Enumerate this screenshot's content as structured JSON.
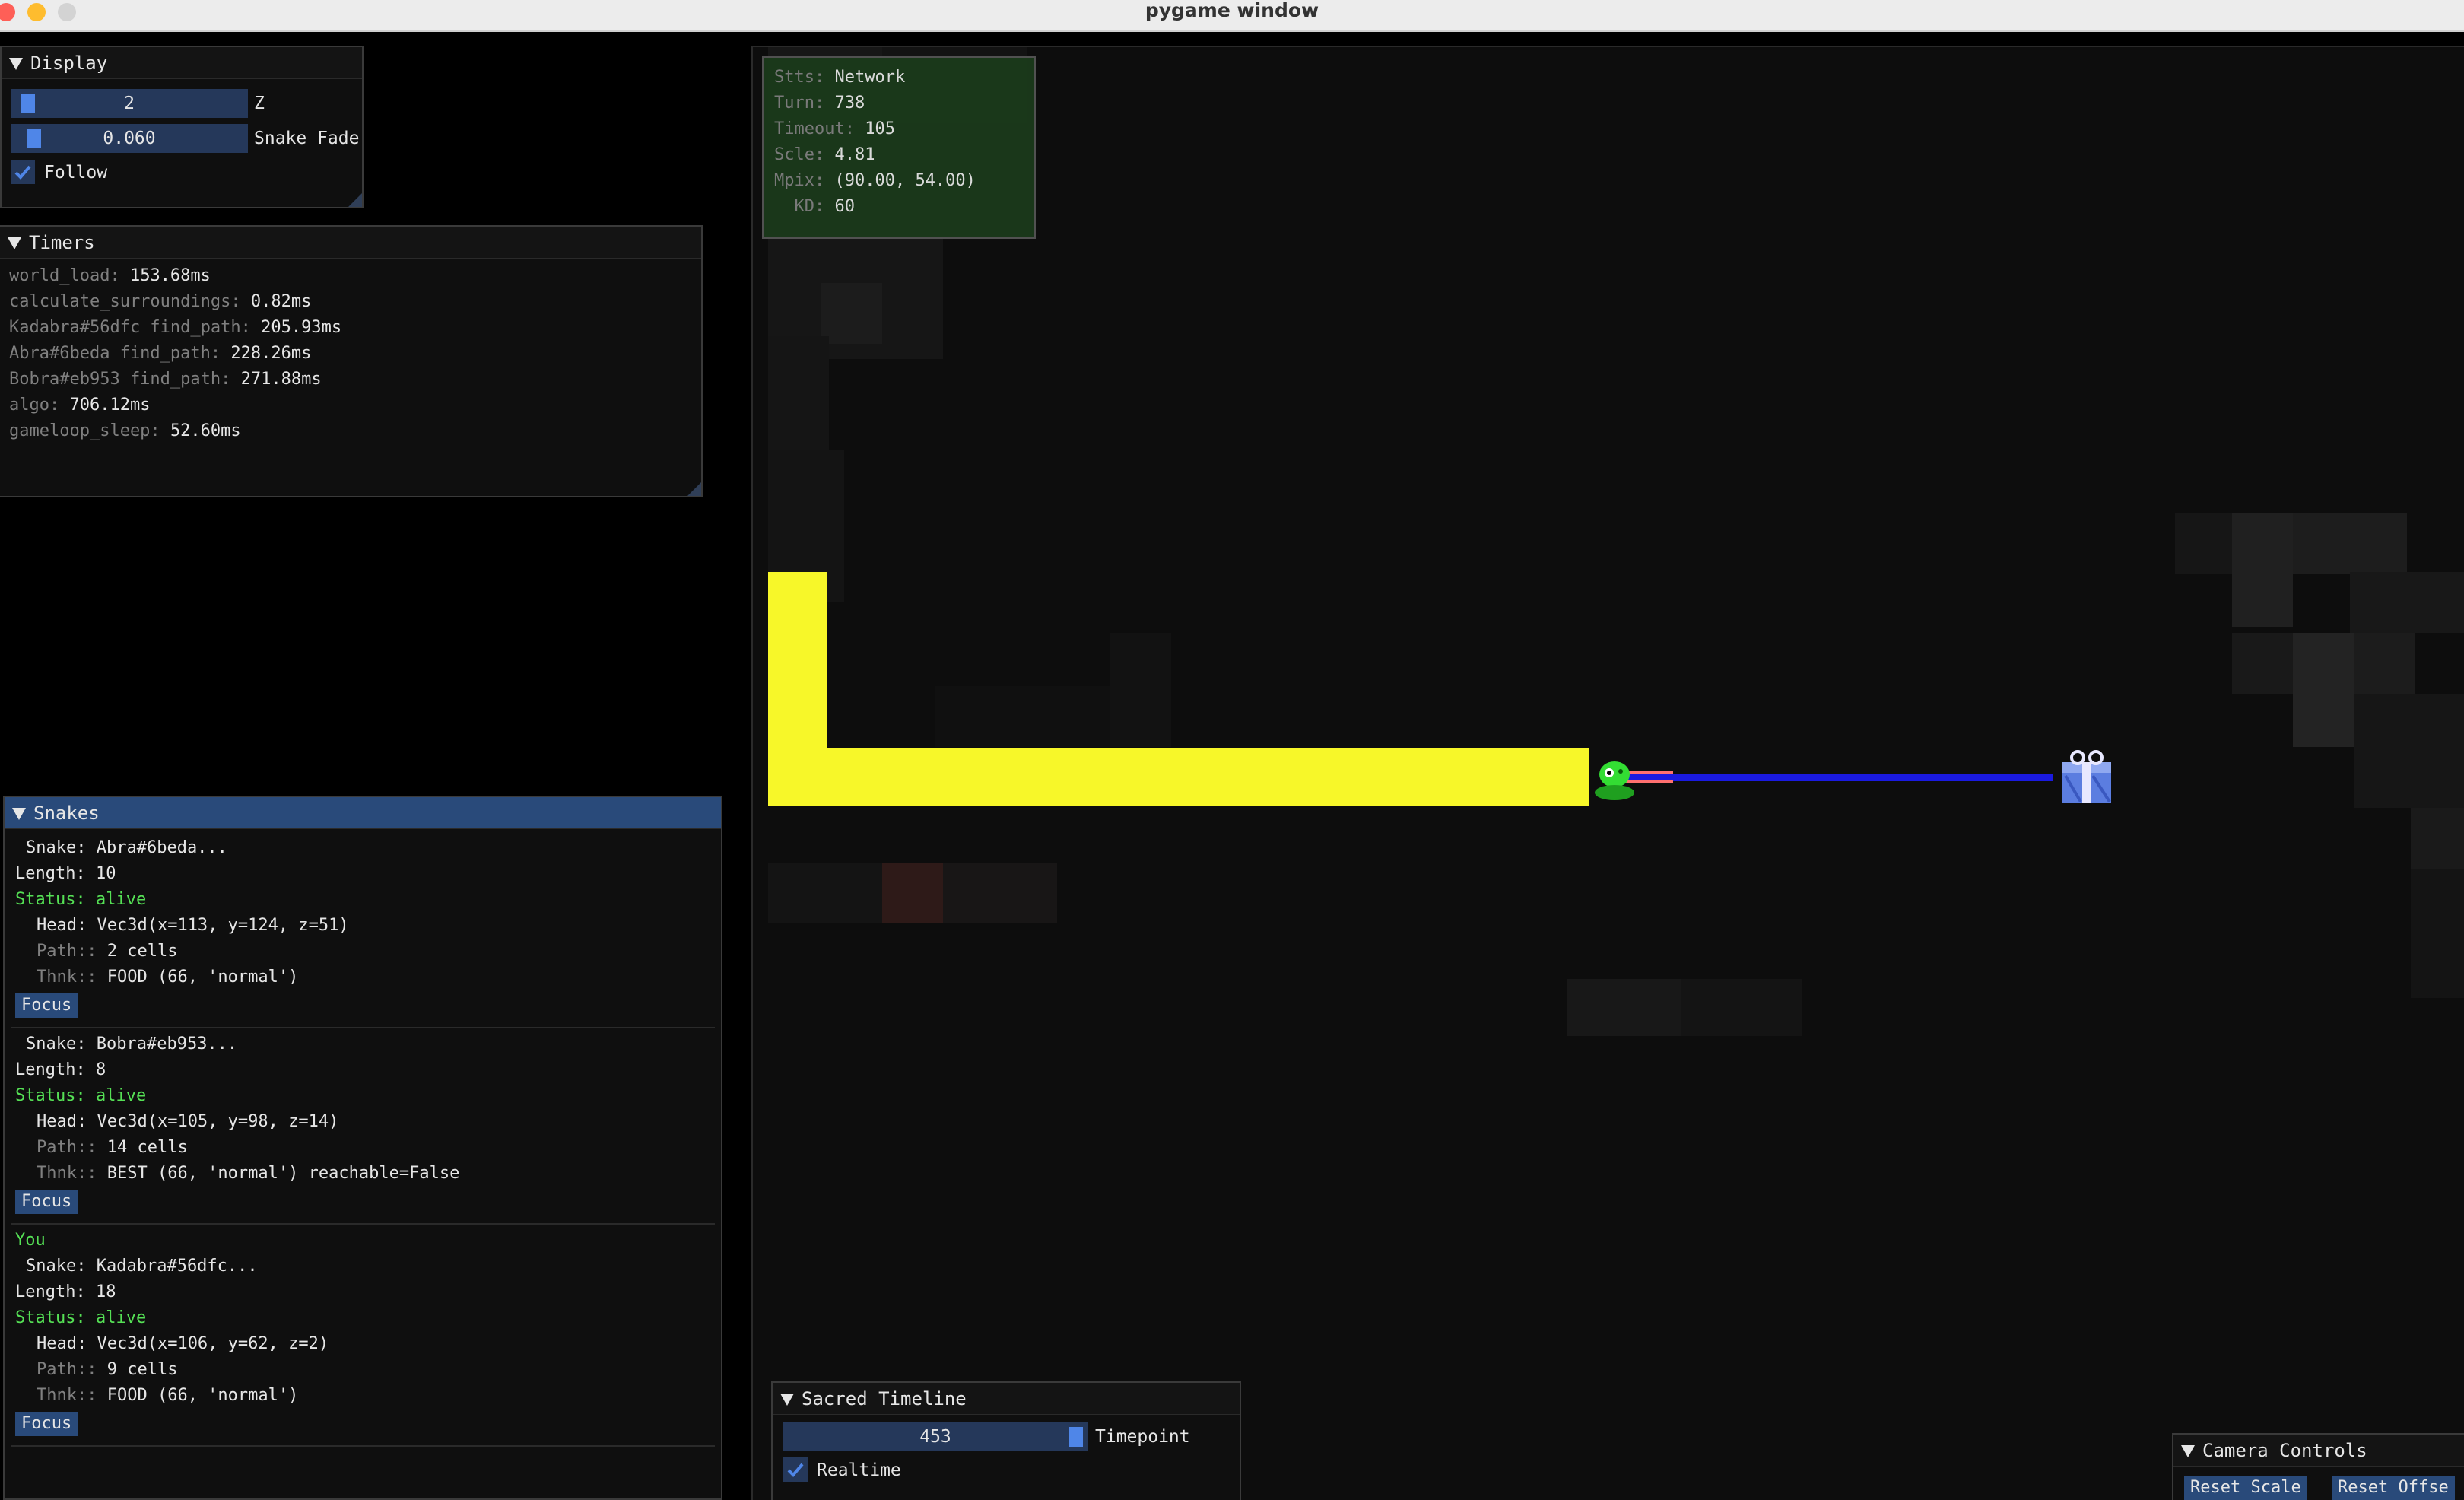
{
  "window": {
    "title": "pygame window"
  },
  "stats": [
    {
      "key": "Stts:",
      "value": "Network"
    },
    {
      "key": "Turn:",
      "value": "738"
    },
    {
      "key": "Timeout:",
      "value": "105"
    },
    {
      "key": "Scle:",
      "value": "4.81"
    },
    {
      "key": "Mpix:",
      "value": "(90.00, 54.00)"
    },
    {
      "key": "  KD:",
      "value": "60"
    }
  ],
  "display": {
    "title": "Display",
    "z_value": "2",
    "z_label": "Z",
    "fade_value": "0.060",
    "fade_label": "Snake Fade",
    "follow_label": "Follow",
    "follow_checked": true
  },
  "timers": {
    "title": "Timers",
    "items": [
      {
        "key": "world_load:",
        "value": "153.68ms"
      },
      {
        "key": "calculate_surroundings:",
        "value": "0.82ms"
      },
      {
        "key": "Kadabra#56dfc find_path:",
        "value": "205.93ms"
      },
      {
        "key": "Abra#6beda find_path:",
        "value": "228.26ms"
      },
      {
        "key": "Bobra#eb953 find_path:",
        "value": "271.88ms"
      },
      {
        "key": "algo:",
        "value": "706.12ms"
      },
      {
        "key": "gameloop_sleep:",
        "value": "52.60ms"
      }
    ]
  },
  "snakes": {
    "title": "Snakes",
    "items": [
      {
        "you": "",
        "snake": "Abra#6beda...",
        "length": "10",
        "status": "alive",
        "head": "Vec3d(x=113, y=124, z=51)",
        "path": "2 cells",
        "thnk": "FOOD (66, 'normal')",
        "focus": "Focus"
      },
      {
        "you": "",
        "snake": "Bobra#eb953...",
        "length": "8",
        "status": "alive",
        "head": "Vec3d(x=105, y=98, z=14)",
        "path": "14 cells",
        "thnk": "BEST (66, 'normal') reachable=False",
        "focus": "Focus"
      },
      {
        "you": "You",
        "snake": "Kadabra#56dfc...",
        "length": "18",
        "status": "alive",
        "head": "Vec3d(x=106, y=62, z=2)",
        "path": "9 cells",
        "thnk": "FOOD (66, 'normal')",
        "focus": "Focus"
      }
    ],
    "labels": {
      "snake": "Snake:",
      "length": "Length:",
      "status": "Status:",
      "head": "Head:",
      "path": "Path::",
      "thnk": "Thnk::"
    }
  },
  "timeline": {
    "title": "Sacred Timeline",
    "value": "453",
    "label": "Timepoint",
    "realtime_label": "Realtime",
    "realtime_checked": true
  },
  "camera": {
    "title": "Camera Controls",
    "reset_scale": "Reset Scale",
    "reset_offset": "Reset Offse"
  },
  "colors": {
    "snake": "#f7f729",
    "path": "#1a1ae0",
    "accent": "#294a7a"
  }
}
